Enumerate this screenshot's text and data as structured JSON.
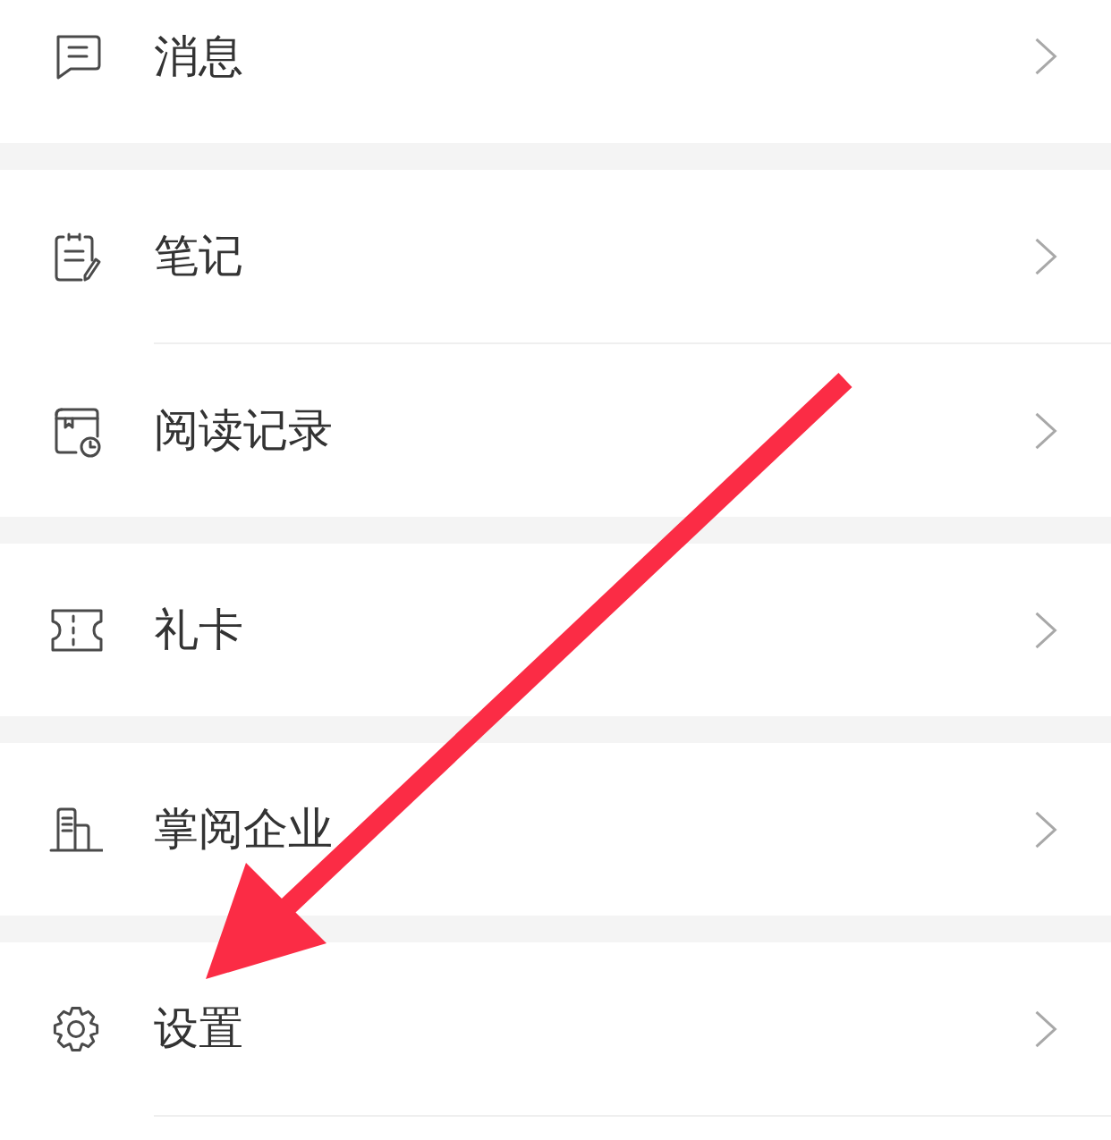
{
  "groups": [
    {
      "items": [
        {
          "label": "消息"
        }
      ]
    },
    {
      "items": [
        {
          "label": "笔记"
        },
        {
          "label": "阅读记录"
        }
      ]
    },
    {
      "items": [
        {
          "label": "礼卡"
        }
      ]
    },
    {
      "items": [
        {
          "label": "掌阅企业"
        }
      ]
    },
    {
      "items": [
        {
          "label": "设置"
        }
      ]
    }
  ]
}
